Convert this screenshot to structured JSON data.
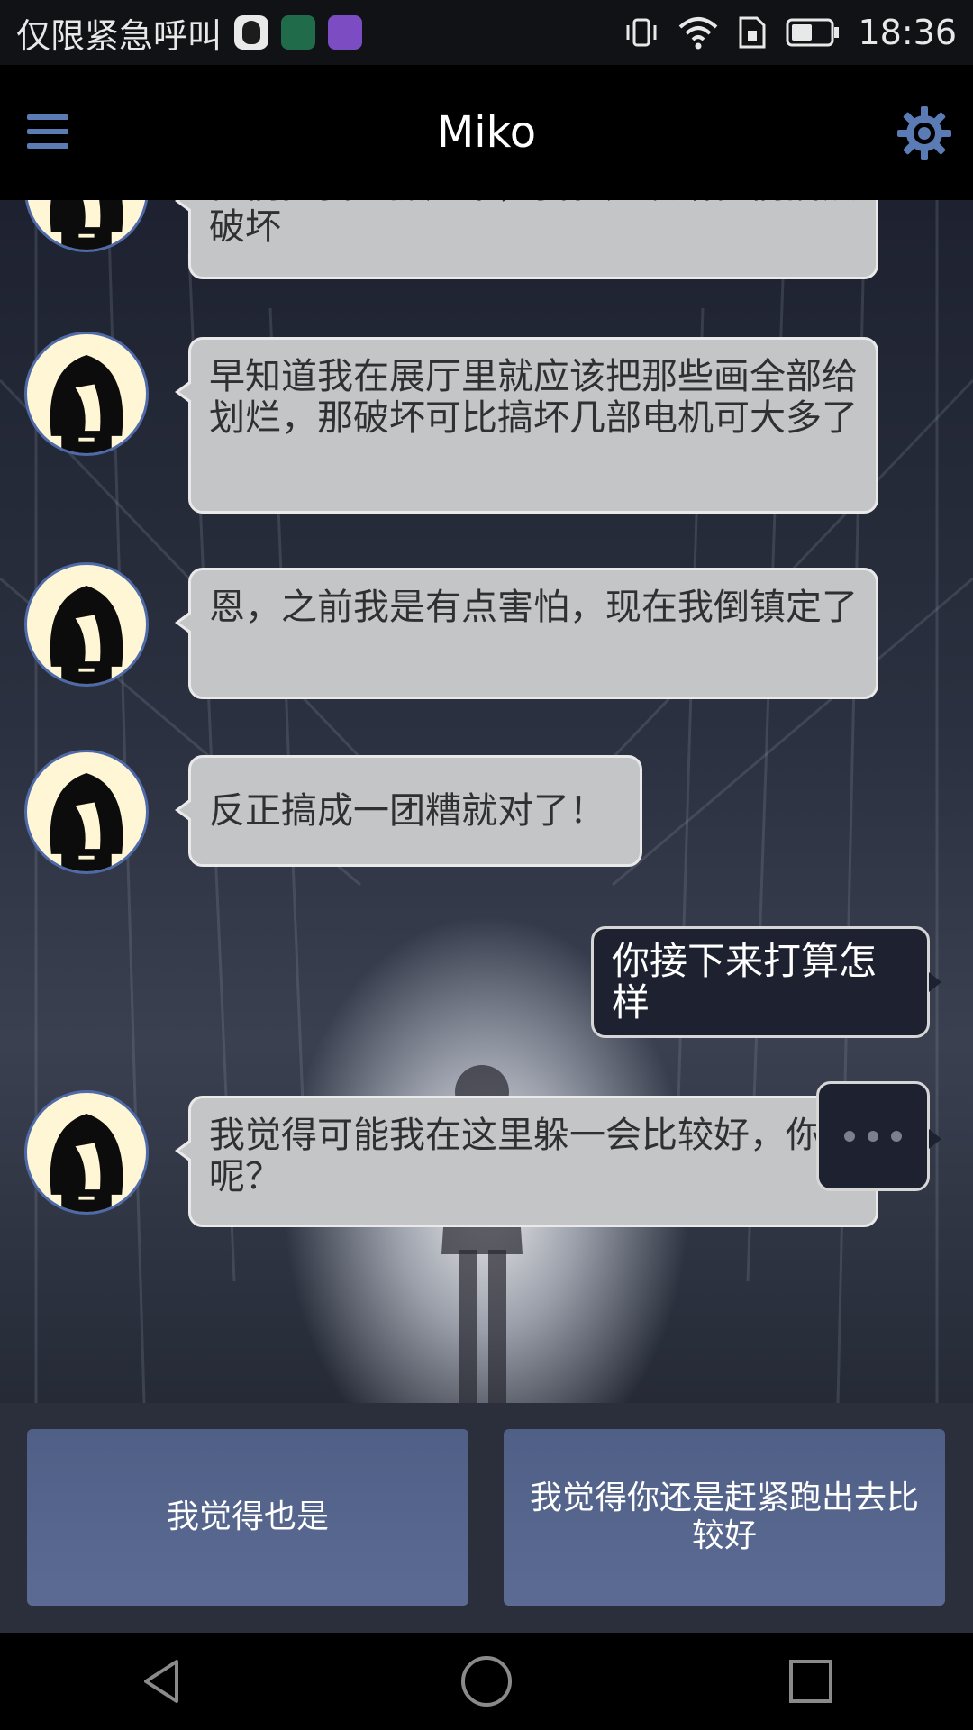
{
  "status_bar": {
    "carrier_text": "仅限紧急呼叫",
    "time": "18:36",
    "icons": [
      "qq-icon",
      "shield-app-icon",
      "gallery-app-icon",
      "vibrate-icon",
      "wifi-icon",
      "sim-icon",
      "battery-icon"
    ]
  },
  "header": {
    "title": "Miko",
    "menu_icon": "hamburger-menu-icon",
    "settings_icon": "gear-icon"
  },
  "messages": [
    {
      "sender": "npc",
      "text": "他们把我也抓起来，我就应该给他们搞点破坏"
    },
    {
      "sender": "npc",
      "text": "早知道我在展厅里就应该把那些画全部给划烂，那破坏可比搞坏几部电机可大多了"
    },
    {
      "sender": "npc",
      "text": "恩，之前我是有点害怕，现在我倒镇定了"
    },
    {
      "sender": "npc",
      "text": "反正搞成一团糟就对了！"
    },
    {
      "sender": "user",
      "text": "你接下来打算怎样"
    },
    {
      "sender": "npc",
      "text": "我觉得可能我在这里躲一会比较好，你说呢？"
    }
  ],
  "typing_indicator": "typing-dots-icon",
  "choices": [
    "我觉得也是",
    "我觉得你还是赶紧跑出去比较好"
  ],
  "nav_bar": [
    "back-icon",
    "home-icon",
    "recents-icon"
  ],
  "colors": {
    "npc_bubble": "#c4c5c6",
    "user_bubble": "#1e2230",
    "choice_button": "#53648c",
    "accent": "#5b7bb5"
  }
}
